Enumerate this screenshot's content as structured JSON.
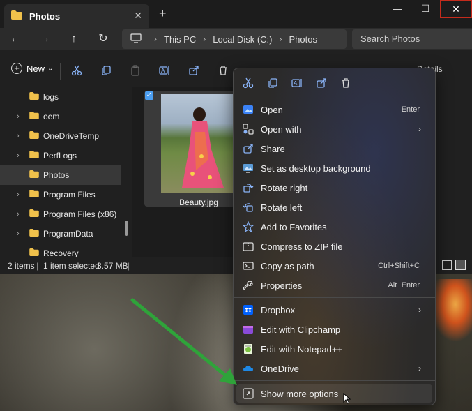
{
  "window": {
    "tab_title": "Photos",
    "tab_close": "✕",
    "new_tab": "+",
    "min": "—",
    "max": "☐",
    "close": "✕"
  },
  "nav": {
    "back": "←",
    "forward": "→",
    "up": "↑",
    "refresh": "↻",
    "breadcrumb": [
      "This PC",
      "Local Disk (C:)",
      "Photos"
    ],
    "search_placeholder": "Search Photos"
  },
  "toolbar": {
    "new_label": "New",
    "new_chevron": "⌄",
    "details_label": "Details"
  },
  "sidebar": {
    "items": [
      {
        "label": "logs",
        "chevron": ""
      },
      {
        "label": "oem",
        "chevron": "›"
      },
      {
        "label": "OneDriveTemp",
        "chevron": "›"
      },
      {
        "label": "PerfLogs",
        "chevron": "›"
      },
      {
        "label": "Photos",
        "chevron": "",
        "selected": true
      },
      {
        "label": "Program Files",
        "chevron": "›"
      },
      {
        "label": "Program Files (x86)",
        "chevron": "›"
      },
      {
        "label": "ProgramData",
        "chevron": "›"
      },
      {
        "label": "Recovery",
        "chevron": ""
      }
    ]
  },
  "content": {
    "file_name": "Beauty.jpg",
    "checkmark": "✓"
  },
  "status": {
    "items_count": "2 items",
    "selected": "1 item selected",
    "size": "3.57 MB",
    "sep": "|"
  },
  "menu": {
    "items": [
      {
        "label": "Open",
        "shortcut": "Enter",
        "icon": "photos-icon"
      },
      {
        "label": "Open with",
        "submenu": "›",
        "icon": "open-with-icon"
      },
      {
        "label": "Share",
        "icon": "share-icon"
      },
      {
        "label": "Set as desktop background",
        "icon": "desktop-background-icon"
      },
      {
        "label": "Rotate right",
        "icon": "rotate-right-icon"
      },
      {
        "label": "Rotate left",
        "icon": "rotate-left-icon"
      },
      {
        "label": "Add to Favorites",
        "icon": "star-icon"
      },
      {
        "label": "Compress to ZIP file",
        "icon": "zip-icon"
      },
      {
        "label": "Copy as path",
        "shortcut": "Ctrl+Shift+C",
        "icon": "copy-path-icon"
      },
      {
        "label": "Properties",
        "shortcut": "Alt+Enter",
        "icon": "wrench-icon"
      },
      {
        "label": "Dropbox",
        "submenu": "›",
        "icon": "dropbox-icon"
      },
      {
        "label": "Edit with Clipchamp",
        "icon": "clipchamp-icon"
      },
      {
        "label": "Edit with Notepad++",
        "icon": "notepad-plus-plus-icon"
      },
      {
        "label": "OneDrive",
        "submenu": "›",
        "icon": "onedrive-icon"
      },
      {
        "label": "Show more options",
        "icon": "more-options-icon"
      }
    ]
  },
  "colors": {
    "accent": "#4c9ef0",
    "arrow": "#2fa33a",
    "close_button_border": "#c42b1c"
  }
}
